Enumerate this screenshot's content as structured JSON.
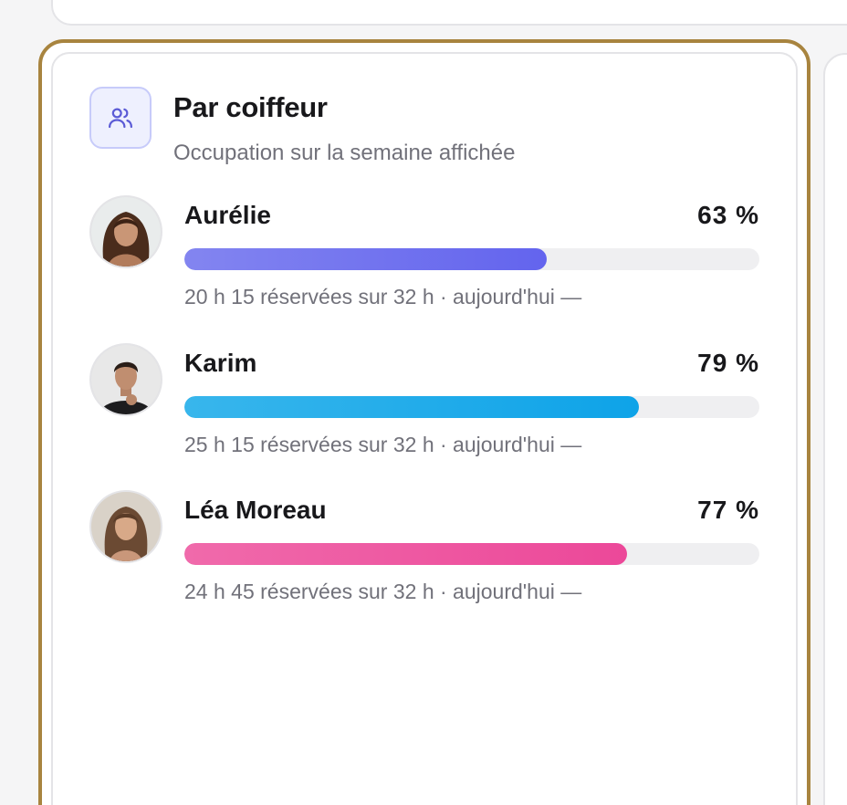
{
  "panel": {
    "title": "Par coiffeur",
    "subtitle": "Occupation sur la semaine affichée",
    "icon": "users-icon",
    "accent": "#5b5bd6",
    "highlight_border": "#a8843f"
  },
  "stylists": [
    {
      "name": "Aurélie",
      "percent_label": "63 %",
      "occupancy": 0.63,
      "detail": "20 h 15 réservées sur 32 h · aujourd'hui —",
      "bar_from": "#8385f0",
      "bar_to": "#6364ee"
    },
    {
      "name": "Karim",
      "percent_label": "79 %",
      "occupancy": 0.79,
      "detail": "25 h 15 réservées sur 32 h · aujourd'hui —",
      "bar_from": "#38b6ec",
      "bar_to": "#0ea3e8"
    },
    {
      "name": "Léa Moreau",
      "percent_label": "77 %",
      "occupancy": 0.77,
      "detail": "24 h 45 réservées sur 32 h · aujourd'hui —",
      "bar_from": "#f06aab",
      "bar_to": "#ec4899"
    }
  ]
}
